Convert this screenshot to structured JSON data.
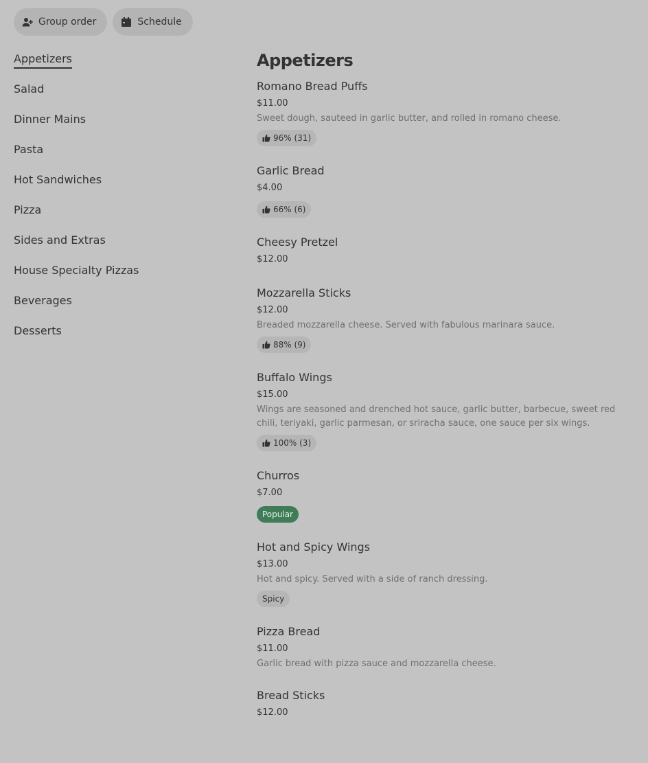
{
  "top_actions": {
    "group_order_label": "Group order",
    "schedule_label": "Schedule"
  },
  "sidebar": {
    "items": [
      {
        "label": "Appetizers",
        "active": true
      },
      {
        "label": "Salad"
      },
      {
        "label": "Dinner Mains"
      },
      {
        "label": "Pasta"
      },
      {
        "label": "Hot Sandwiches"
      },
      {
        "label": "Pizza"
      },
      {
        "label": "Sides and Extras"
      },
      {
        "label": "House Specialty Pizzas"
      },
      {
        "label": "Beverages"
      },
      {
        "label": "Desserts"
      }
    ]
  },
  "main": {
    "section_title": "Appetizers",
    "items": [
      {
        "name": "Romano Bread Puffs",
        "price": "$11.00",
        "description": "Sweet dough, sauteed in garlic butter, and rolled in romano cheese.",
        "rating": "96% (31)"
      },
      {
        "name": "Garlic Bread",
        "price": "$4.00",
        "rating": "66% (6)"
      },
      {
        "name": "Cheesy Pretzel",
        "price": "$12.00"
      },
      {
        "name": "Mozzarella Sticks",
        "price": "$12.00",
        "description": "Breaded mozzarella cheese. Served with fabulous marinara sauce.",
        "rating": "88% (9)"
      },
      {
        "name": "Buffalo Wings",
        "price": "$15.00",
        "description": "Wings are seasoned and drenched hot sauce, garlic butter, barbecue, sweet red chili, teriyaki, garlic parmesan, or sriracha sauce, one sauce per six wings.",
        "rating": "100% (3)"
      },
      {
        "name": "Churros",
        "price": "$7.00",
        "tag": "Popular",
        "tag_style": "popular"
      },
      {
        "name": "Hot and Spicy Wings",
        "price": "$13.00",
        "description": "Hot and spicy. Served with a side of ranch dressing.",
        "tag": "Spicy",
        "tag_style": "plain"
      },
      {
        "name": "Pizza Bread",
        "price": "$11.00",
        "description": "Garlic bread with pizza sauce and mozzarella cheese."
      },
      {
        "name": "Bread Sticks",
        "price": "$12.00"
      }
    ]
  },
  "colors": {
    "background": "#c3c3c3",
    "pill": "#b4b4b4",
    "popular": "#3f7c57"
  }
}
